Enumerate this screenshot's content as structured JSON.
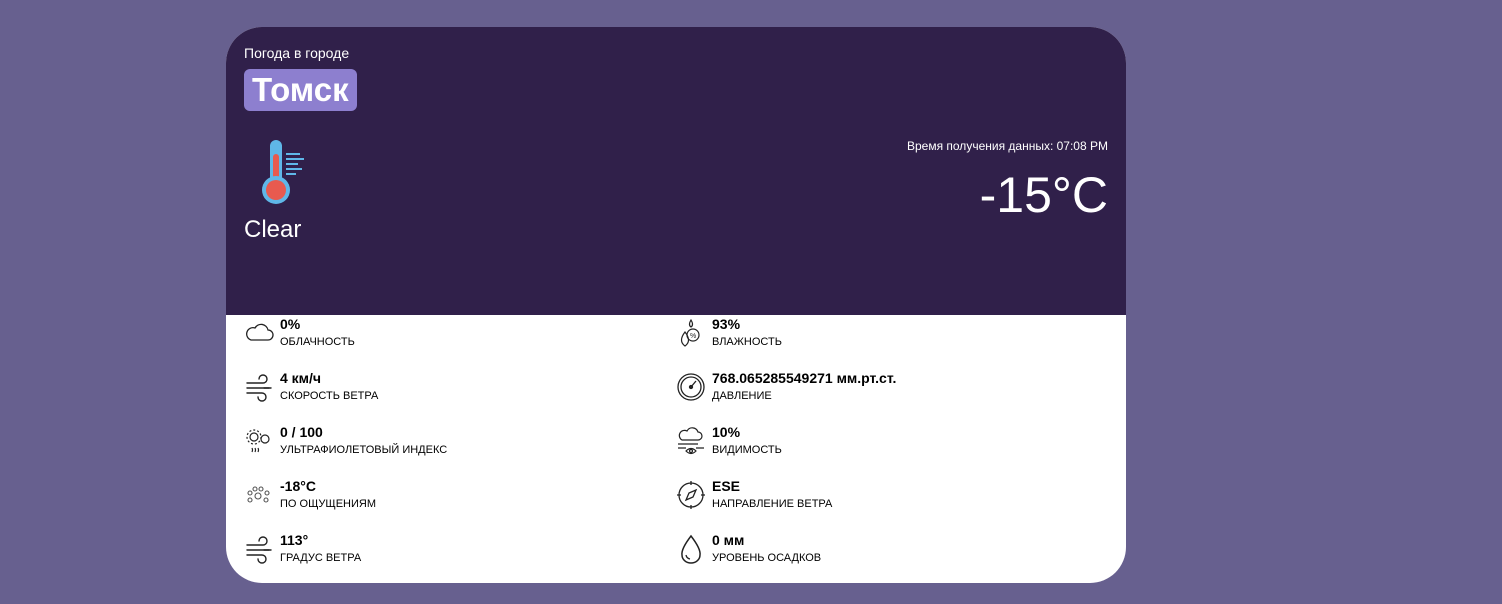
{
  "header": {
    "subtitle": "Погода в городе",
    "city": "Томск",
    "condition": "Clear",
    "time_label": "Время получения данных: 07:08 PM",
    "temperature": "-15°C"
  },
  "colors": {
    "background": "#67608f",
    "card_header": "#30204a",
    "city_badge": "#8d7fcf"
  },
  "stats": {
    "left": [
      {
        "icon": "cloud-icon",
        "value": "0%",
        "label": "ОБЛАЧНОСТЬ"
      },
      {
        "icon": "wind-icon",
        "value": "4 км/ч",
        "label": "СКОРОСТЬ ВЕТРА"
      },
      {
        "icon": "uv-icon",
        "value": "0 / 100",
        "label": "УЛЬТРАФИОЛЕТОВЫЙ ИНДЕКС"
      },
      {
        "icon": "feels-like-icon",
        "value": "-18°C",
        "label": "ПО ОЩУЩЕНИЯМ"
      },
      {
        "icon": "wind-degree-icon",
        "value": "113°",
        "label": "ГРАДУС ВЕТРА"
      }
    ],
    "right": [
      {
        "icon": "humidity-icon",
        "value": "93%",
        "label": "ВЛАЖНОСТЬ"
      },
      {
        "icon": "pressure-gauge-icon",
        "value": "768.065285549271 мм.рт.ст.",
        "label": "ДАВЛЕНИЕ"
      },
      {
        "icon": "visibility-icon",
        "value": "10%",
        "label": "ВИДИМОСТЬ"
      },
      {
        "icon": "compass-icon",
        "value": "ESE",
        "label": "НАПРАВЛЕНИЕ ВЕТРА"
      },
      {
        "icon": "raindrop-icon",
        "value": "0 мм",
        "label": "УРОВЕНЬ ОСАДКОВ"
      }
    ]
  }
}
